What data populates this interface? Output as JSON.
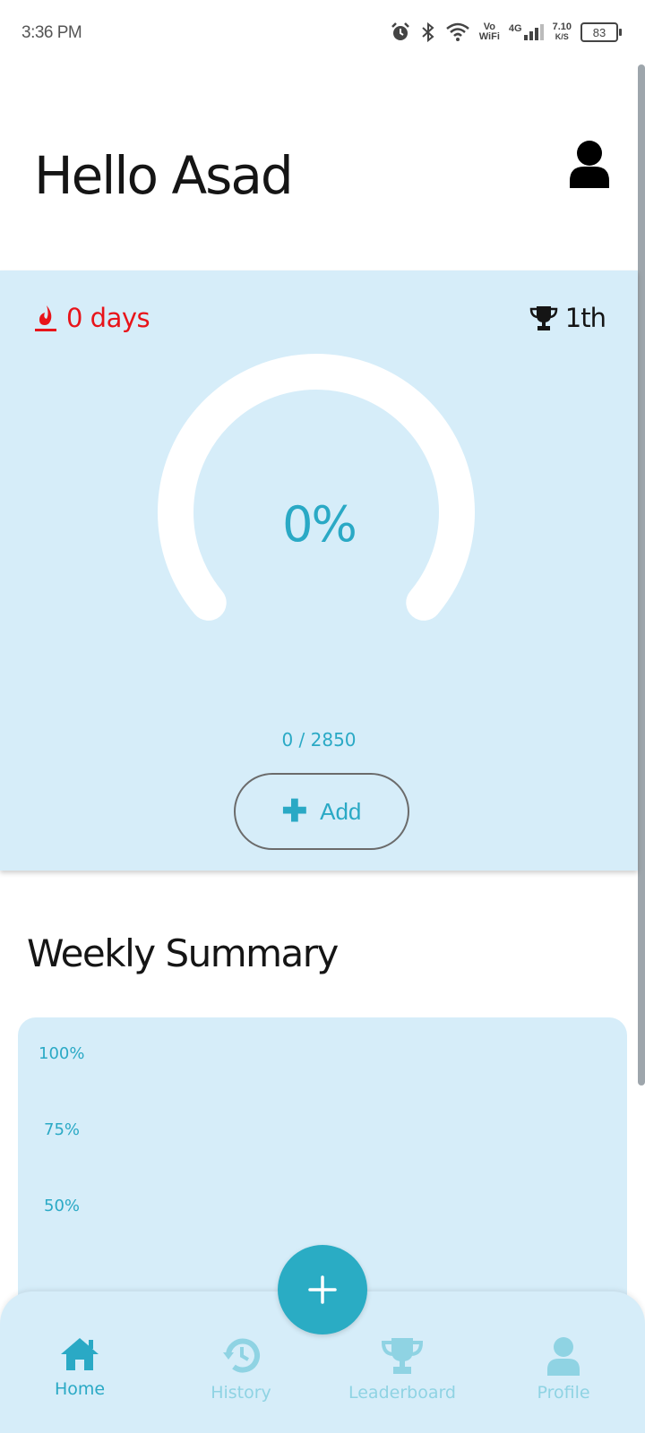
{
  "status_bar": {
    "time": "3:36 PM",
    "network_labels": [
      "Vo",
      "WiFi"
    ],
    "signal_label": "4G",
    "speed_value": "7.10",
    "speed_unit": "K/S",
    "battery": "83"
  },
  "header": {
    "greeting": "Hello Asad",
    "profile_icon": "user-icon"
  },
  "hero": {
    "streak_text": "0 days",
    "streak_icon": "flame-icon",
    "rank_text": "1th",
    "rank_icon": "trophy-icon",
    "progress_percent_label": "0%",
    "progress_fraction": 0,
    "progress_count": "0 / 2850",
    "add_button_label": "Add",
    "colors": {
      "accent": "#2aa9c5",
      "streak": "#e8141a",
      "panel": "#d6edf9"
    }
  },
  "weekly_summary": {
    "title": "Weekly Summary",
    "y_ticks": [
      "100%",
      "75%",
      "50%"
    ]
  },
  "fab": {
    "icon": "plus-icon"
  },
  "bottom_nav": {
    "items": [
      {
        "label": "Home",
        "icon": "home-icon",
        "active": true
      },
      {
        "label": "History",
        "icon": "history-icon",
        "active": false
      },
      {
        "label": "Leaderboard",
        "icon": "trophy-icon",
        "active": false
      },
      {
        "label": "Profile",
        "icon": "user-icon",
        "active": false
      }
    ]
  }
}
